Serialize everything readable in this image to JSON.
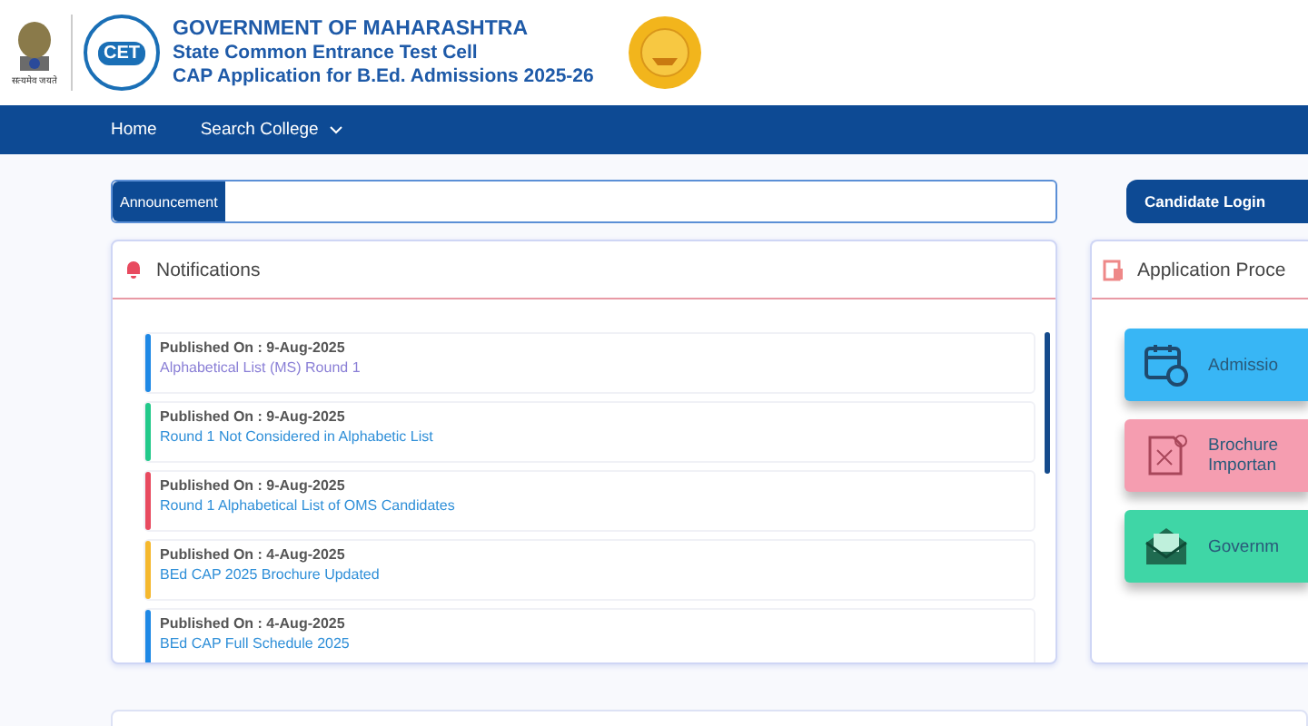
{
  "header": {
    "emblem_caption": "सत्यमेव जयते",
    "logo_text": "CET",
    "lines": [
      "GOVERNMENT OF MAHARASHTRA",
      "State Common Entrance Test Cell",
      "CAP Application for B.Ed. Admissions 2025-26"
    ]
  },
  "nav": [
    {
      "label": "Home",
      "dropdown": false
    },
    {
      "label": "Search College",
      "dropdown": true
    }
  ],
  "announcement": {
    "label": "Announcement"
  },
  "login_button": "Candidate Login",
  "notifications": {
    "title": "Notifications",
    "items": [
      {
        "published": "Published On : 9-Aug-2025",
        "link": "Alphabetical List (MS) Round 1",
        "color": "#1e88e5",
        "visited": true
      },
      {
        "published": "Published On : 9-Aug-2025",
        "link": "Round 1 Not Considered in Alphabetic List",
        "color": "#22c98a",
        "visited": false
      },
      {
        "published": "Published On : 9-Aug-2025",
        "link": "Round 1 Alphabetical List of OMS Candidates",
        "color": "#e84a5f",
        "visited": false
      },
      {
        "published": "Published On : 4-Aug-2025",
        "link": "BEd CAP 2025 Brochure Updated",
        "color": "#f5b82e",
        "visited": false
      },
      {
        "published": "Published On : 4-Aug-2025",
        "link": "BEd CAP Full Schedule 2025",
        "color": "#1e88e5",
        "visited": false
      }
    ]
  },
  "process": {
    "title": "Application Proce",
    "cards": [
      {
        "kind": "calendar",
        "lines": [
          "Admissio"
        ],
        "color": "#38b6f5"
      },
      {
        "kind": "brochure",
        "lines": [
          "Brochure",
          "Importan"
        ],
        "color": "#f59db0"
      },
      {
        "kind": "envelope",
        "lines": [
          "Governm"
        ],
        "color": "#3fd6a6"
      }
    ]
  }
}
